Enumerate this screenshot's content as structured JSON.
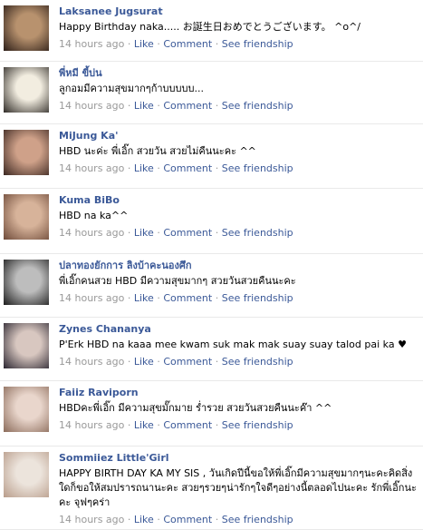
{
  "comments": [
    {
      "name": "Laksanee Jugsurat",
      "message": "Happy Birthday naka..... お誕生日おめでとうございます。 ^o^/",
      "time": "14 hours ago",
      "avatar_colors": [
        "#b8926e",
        "#2b1d17"
      ]
    },
    {
      "name": "พี่หมี ขี้บ่น",
      "message": "ลูกอมมีความสุขมากๆก้าบบบบบ...",
      "time": "14 hours ago",
      "avatar_colors": [
        "#f2ede0",
        "#2e2a26"
      ]
    },
    {
      "name": "MiJung Ka'",
      "message": "HBD นะค่ะ พี่เอิ๊ก สวยวัน สวยไม่คืนนะคะ ^^",
      "time": "14 hours ago",
      "avatar_colors": [
        "#cfa189",
        "#3a2620"
      ]
    },
    {
      "name": "Kuma BiBo",
      "message": "HBD na ka^^",
      "time": "14 hours ago",
      "avatar_colors": [
        "#d7b39a",
        "#6e4a39"
      ]
    },
    {
      "name": "ปลาทองยักการ ลิงบ้าคะนองศึก",
      "message": "พี่เอิ๊กคนสวย HBD มีความสุขมากๆ สวยวันสวยคืนนะคะ",
      "time": "14 hours ago",
      "avatar_colors": [
        "#bdbdbd",
        "#1b1b1b"
      ]
    },
    {
      "name": "Zynes Chananya",
      "message": "P'Erk HBD na kaaa mee kwam suk mak mak suay suay talod pai ka ♥",
      "time": "14 hours ago",
      "avatar_colors": [
        "#d8c7c0",
        "#2a2530"
      ]
    },
    {
      "name": "Faiiz Raviporn",
      "message": "HBDคะพี่เอิ๊ก มีความสุขมั๊กมาย ร่ำรวย สวยวันสวยคืนนะค๊า ^^",
      "time": "14 hours ago",
      "avatar_colors": [
        "#e9d6cc",
        "#8b6b5a"
      ]
    },
    {
      "name": "Sommiiez Little'Girl",
      "message": "HAPPY BIRTH DAY KA MY SIS , วันเกิดปีนี้ขอให้พี่เอิ๊กมีความสุขมากๆนะคะคิดสิ่งใดก็ขอให้สมปรารถนานะคะ สวยๆรวยๆน่ารักๆใจดีๆอย่างนี้ตลอดไปนะคะ รักพี่เอิ๊กนะคะ จุฟๆคร่า",
      "time": "14 hours ago",
      "avatar_colors": [
        "#ece4dc",
        "#b89c8a"
      ]
    }
  ],
  "actions": {
    "separator": "·",
    "like": "Like",
    "comment": "Comment",
    "see_friendship": "See friendship"
  }
}
